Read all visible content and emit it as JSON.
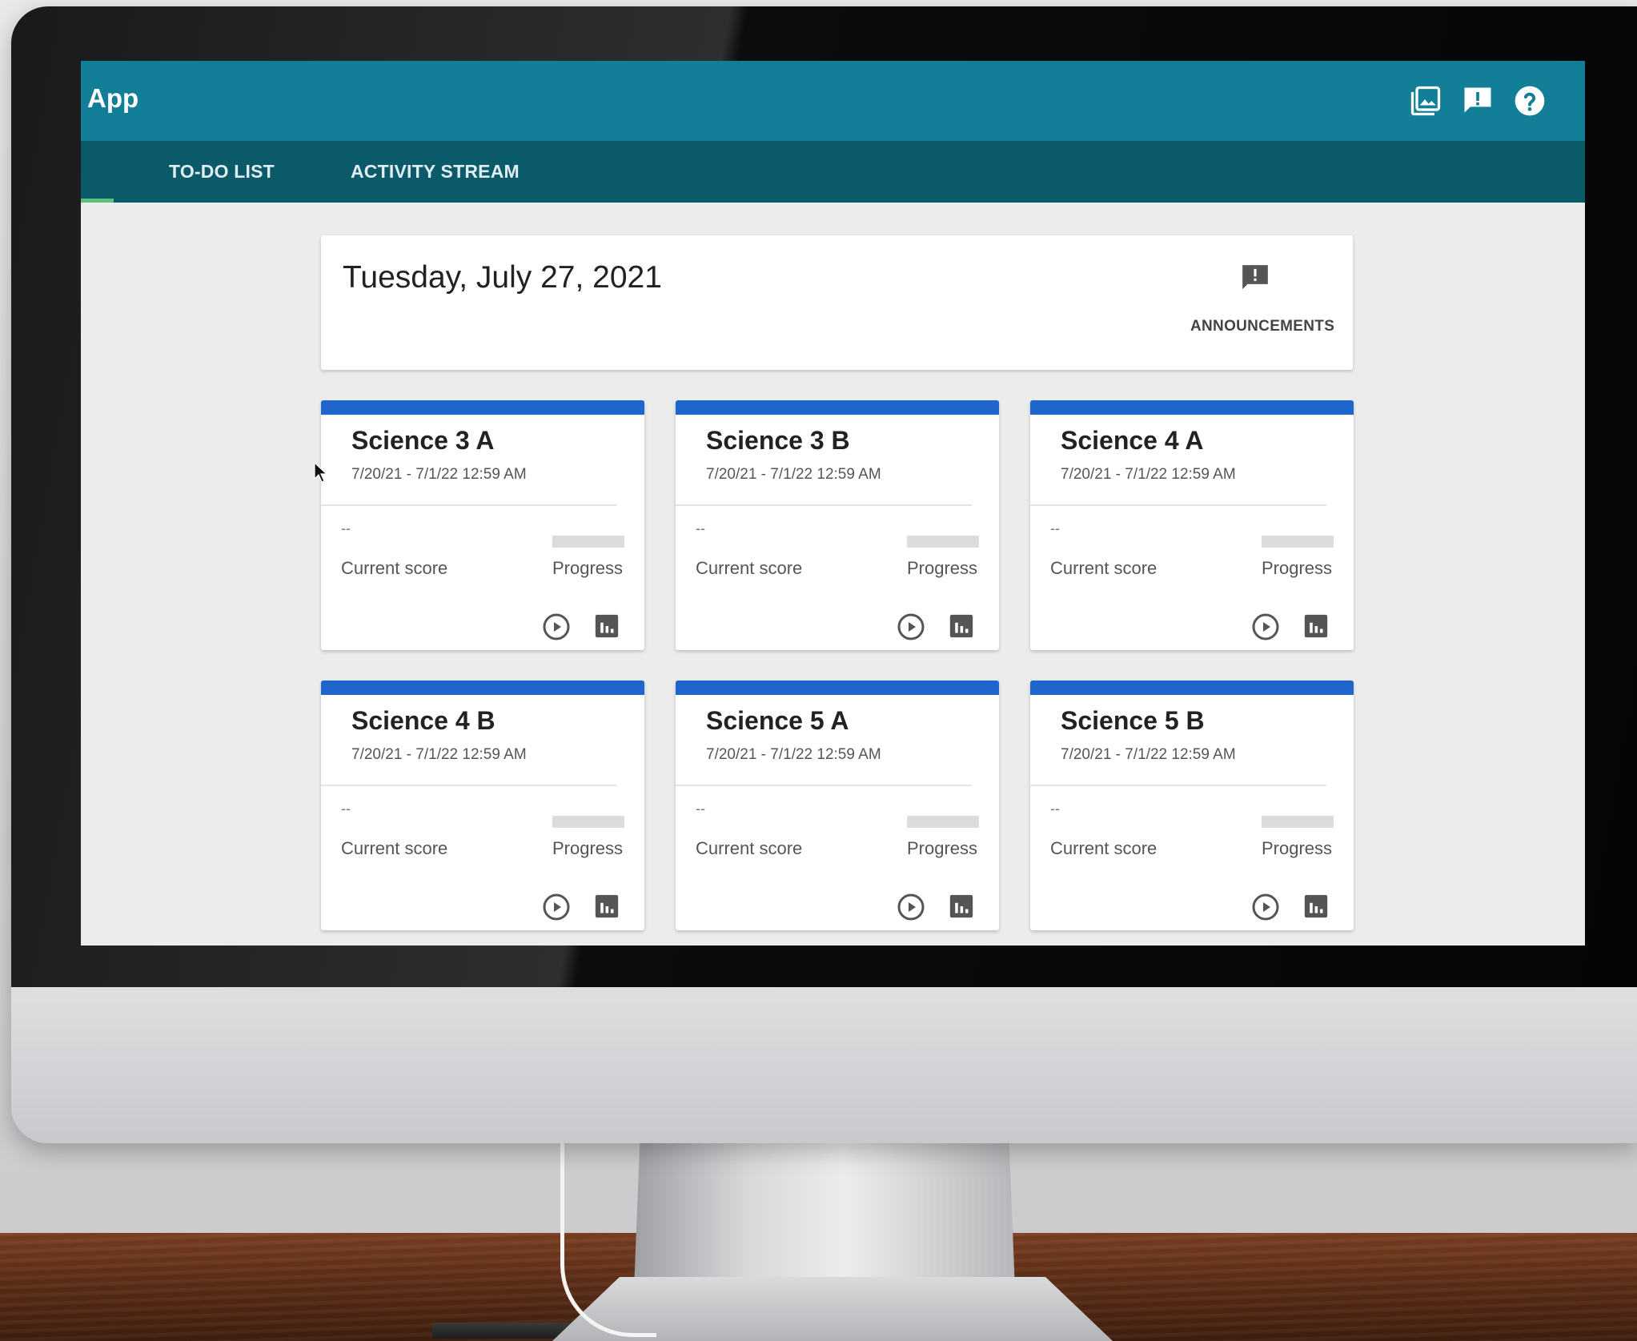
{
  "app": {
    "title": "App",
    "colors": {
      "appbar": "#127e98",
      "tabbar": "#0b5a6a",
      "accent": "#1f66cc",
      "tab_indicator": "#5fbf7a"
    },
    "toolbar_icons": [
      "gallery-icon",
      "feedback-icon",
      "help-icon"
    ]
  },
  "tabs": [
    {
      "label": "TO-DO LIST",
      "active": true
    },
    {
      "label": "ACTIVITY STREAM",
      "active": false
    }
  ],
  "date_card": {
    "date": "Tuesday, July 27, 2021",
    "announcements_label": "ANNOUNCEMENTS",
    "announcements_icon": "announcement-icon"
  },
  "courses": [
    {
      "title": "Science 3 A",
      "dates": "7/20/21 - 7/1/22 12:59 AM",
      "score": "--",
      "score_label": "Current score",
      "progress_label": "Progress",
      "progress": 0
    },
    {
      "title": "Science 3 B",
      "dates": "7/20/21 - 7/1/22 12:59 AM",
      "score": "--",
      "score_label": "Current score",
      "progress_label": "Progress",
      "progress": 0
    },
    {
      "title": "Science 4 A",
      "dates": "7/20/21 - 7/1/22 12:59 AM",
      "score": "--",
      "score_label": "Current score",
      "progress_label": "Progress",
      "progress": 0
    },
    {
      "title": "Science 4 B",
      "dates": "7/20/21 - 7/1/22 12:59 AM",
      "score": "--",
      "score_label": "Current score",
      "progress_label": "Progress",
      "progress": 0
    },
    {
      "title": "Science 5 A",
      "dates": "7/20/21 - 7/1/22 12:59 AM",
      "score": "--",
      "score_label": "Current score",
      "progress_label": "Progress",
      "progress": 0
    },
    {
      "title": "Science 5 B",
      "dates": "7/20/21 - 7/1/22 12:59 AM",
      "score": "--",
      "score_label": "Current score",
      "progress_label": "Progress",
      "progress": 0
    }
  ]
}
